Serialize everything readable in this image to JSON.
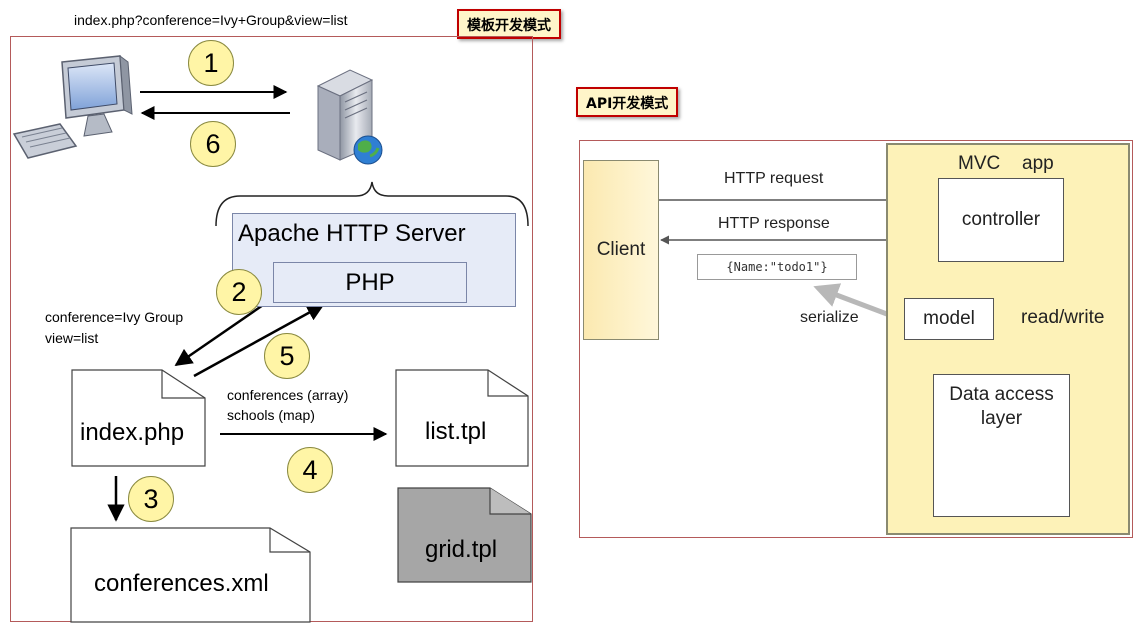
{
  "tags": {
    "template_mode": "模板开发模式",
    "api_mode": "API开发模式"
  },
  "left": {
    "request_url": "index.php?conference=Ivy+Group&view=list",
    "server_title": "Apache HTTP Server",
    "php_label": "PHP",
    "params_line1": "conference=Ivy Group",
    "params_line2": "view=list",
    "index_file": "index.php",
    "vars_line1": "conferences (array)",
    "vars_line2": "schools (map)",
    "list_tpl": "list.tpl",
    "grid_tpl": "grid.tpl",
    "xml_file": "conferences.xml",
    "steps": [
      "1",
      "2",
      "3",
      "4",
      "5",
      "6"
    ]
  },
  "right": {
    "client": "Client",
    "mvc_label": "MVC",
    "app_label": "app",
    "http_request": "HTTP request",
    "http_response": "HTTP response",
    "json_sample": "{Name:\"todo1\"}",
    "serialize": "serialize",
    "controller": "controller",
    "model": "model",
    "read_write": "read/write",
    "data_access_line1": "Data access",
    "data_access_line2": "layer"
  },
  "colors": {
    "step_circle": "#fff5a6",
    "tag_background": "#fff5c9",
    "tag_border": "#c00000",
    "apache_box": "#e6ebf7",
    "mvc_box": "#fdf2b8",
    "grid_tpl_fill": "#a6a6a6"
  }
}
